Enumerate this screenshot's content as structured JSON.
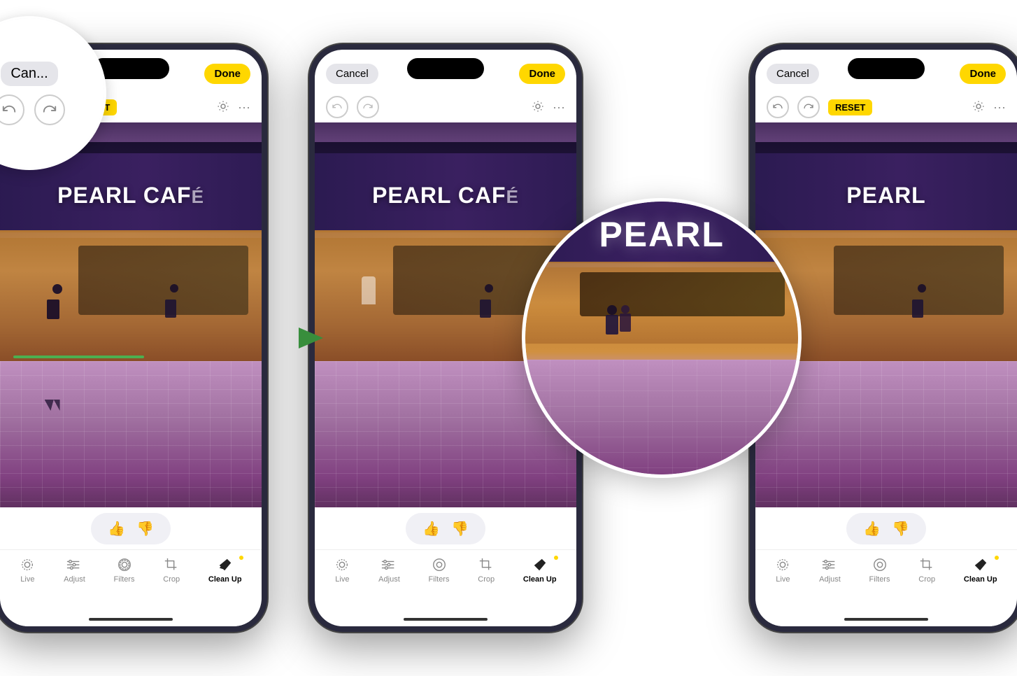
{
  "phones": [
    {
      "id": "phone1",
      "topBar": {
        "cancelLabel": "Cancel",
        "doneLabel": "Done",
        "showReset": true,
        "resetLabel": "RESET"
      },
      "toolbar": {
        "items": [
          {
            "id": "live",
            "label": "Live",
            "active": false
          },
          {
            "id": "adjust",
            "label": "Adjust",
            "active": false
          },
          {
            "id": "filters",
            "label": "Filters",
            "active": false
          },
          {
            "id": "crop",
            "label": "Crop",
            "active": false
          },
          {
            "id": "cleanup",
            "label": "Clean Up",
            "active": true
          }
        ]
      },
      "hasZoomCircleTopLeft": true,
      "signText": "PEARL CAF",
      "hasArrow": true
    },
    {
      "id": "phone2",
      "topBar": {
        "cancelLabel": "Cancel",
        "doneLabel": "Done",
        "showReset": false,
        "resetLabel": ""
      },
      "toolbar": {
        "items": [
          {
            "id": "live",
            "label": "Live",
            "active": false
          },
          {
            "id": "adjust",
            "label": "Adjust",
            "active": false
          },
          {
            "id": "filters",
            "label": "Filters",
            "active": false
          },
          {
            "id": "crop",
            "label": "Crop",
            "active": false
          },
          {
            "id": "cleanup",
            "label": "Clean Up",
            "active": true
          }
        ]
      },
      "hasZoomCircleTopLeft": false,
      "signText": "PEARL CAF",
      "hasZoomCircleRight": true
    },
    {
      "id": "phone3",
      "topBar": {
        "cancelLabel": "Cancel",
        "doneLabel": "Done",
        "showReset": true,
        "resetLabel": "RESET"
      },
      "toolbar": {
        "items": [
          {
            "id": "live",
            "label": "Live",
            "active": false
          },
          {
            "id": "adjust",
            "label": "Adjust",
            "active": false
          },
          {
            "id": "filters",
            "label": "Filters",
            "active": false
          },
          {
            "id": "crop",
            "label": "Crop",
            "active": false
          },
          {
            "id": "cleanup",
            "label": "Clean Up",
            "active": true
          }
        ]
      },
      "hasZoomCircleTopLeft": false,
      "signText": "PEARL",
      "hasZoomCircleRight": false
    }
  ],
  "zoomCircle": {
    "signText": "PEARL"
  },
  "magnifiedTopLeft": {
    "cancelLabel": "Can...",
    "undoIcon": "↩",
    "redoIcon": "↪"
  },
  "arrow": {
    "color": "#4caf50"
  }
}
